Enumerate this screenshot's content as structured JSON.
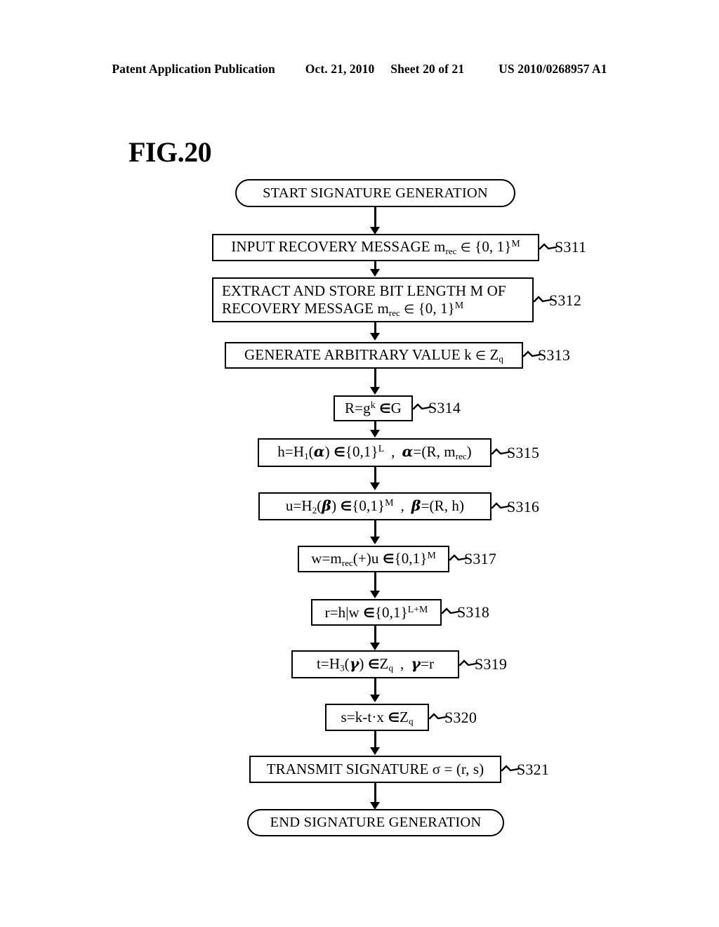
{
  "header": {
    "publication": "Patent Application Publication",
    "date": "Oct. 21, 2010",
    "sheet": "Sheet 20 of 21",
    "doc_number": "US 2010/0268957 A1"
  },
  "figure": {
    "title": "FIG.20"
  },
  "flowchart": {
    "start_label": "START SIGNATURE GENERATION",
    "end_label": "END SIGNATURE GENERATION",
    "steps": [
      {
        "id": "S311",
        "text": "INPUT RECOVERY MESSAGE m_rec ∈ {0, 1}^M",
        "label": "S311"
      },
      {
        "id": "S312",
        "text": "EXTRACT AND STORE BIT LENGTH M OF RECOVERY MESSAGE m_rec ∈ {0, 1}^M",
        "line1": "EXTRACT AND STORE BIT LENGTH M OF",
        "line2": "RECOVERY MESSAGE m_rec ∈ {0, 1}^M",
        "label": "S312"
      },
      {
        "id": "S313",
        "text": "GENERATE ARBITRARY VALUE k ∈ Z_q",
        "label": "S313"
      },
      {
        "id": "S314",
        "text": "R=g^k ∈ G",
        "label": "S314"
      },
      {
        "id": "S315",
        "text": "h=H_1(α) ∈ {0,1}^L , α=(R, m_rec)",
        "label": "S315"
      },
      {
        "id": "S316",
        "text": "u=H_2(β) ∈ {0,1}^M , β=(R, h)",
        "label": "S316"
      },
      {
        "id": "S317",
        "text": "w=m_rec(+)u ∈ {0,1}^M",
        "label": "S317"
      },
      {
        "id": "S318",
        "text": "r=h|w ∈ {0,1}^L+M",
        "label": "S318"
      },
      {
        "id": "S319",
        "text": "t=H_3(γ) ∈Z_q , γ=r",
        "label": "S319"
      },
      {
        "id": "S320",
        "text": "s=k-t·x ∈Z_q",
        "label": "S320"
      },
      {
        "id": "S321",
        "text": "TRANSMIT SIGNATURE σ = (r, s)",
        "label": "S321"
      }
    ]
  },
  "colors": {
    "ink": "#000000",
    "paper": "#ffffff"
  }
}
